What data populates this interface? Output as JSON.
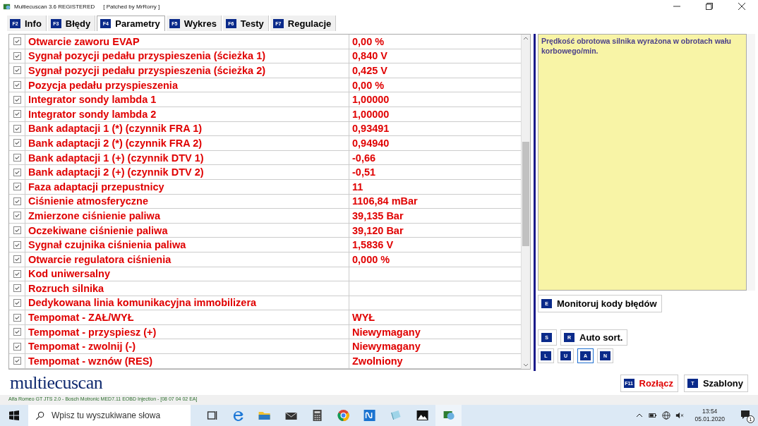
{
  "window": {
    "title": "Multiecuscan 3.6 REGISTERED",
    "subtitle": "[ Patched by MrRorry ]"
  },
  "tabs": [
    {
      "key": "F2",
      "label": "Info",
      "selected": false
    },
    {
      "key": "F3",
      "label": "Błędy",
      "selected": false
    },
    {
      "key": "F4",
      "label": "Parametry",
      "selected": true
    },
    {
      "key": "F5",
      "label": "Wykres",
      "selected": false
    },
    {
      "key": "F6",
      "label": "Testy",
      "selected": false
    },
    {
      "key": "F7",
      "label": "Regulacje",
      "selected": false
    }
  ],
  "parameters": [
    {
      "name": "Otwarcie zaworu EVAP",
      "value": "0,00 %",
      "checked": true
    },
    {
      "name": "Sygnał pozycji pedału przyspieszenia (ścieżka 1)",
      "value": "0,840 V",
      "checked": true
    },
    {
      "name": "Sygnał pozycji pedału przyspieszenia (ścieżka 2)",
      "value": "0,425 V",
      "checked": true
    },
    {
      "name": "Pozycja pedału przyspieszenia",
      "value": "0,00 %",
      "checked": true
    },
    {
      "name": "Integrator sondy lambda 1",
      "value": "1,00000",
      "checked": true
    },
    {
      "name": "Integrator sondy lambda 2",
      "value": "1,00000",
      "checked": true
    },
    {
      "name": "Bank adaptacji 1 (*) (czynnik FRA 1)",
      "value": "0,93491",
      "checked": true
    },
    {
      "name": "Bank adaptacji 2 (*) (czynnik FRA 2)",
      "value": "0,94940",
      "checked": true
    },
    {
      "name": "Bank adaptacji 1 (+) (czynnik DTV 1)",
      "value": "-0,66",
      "checked": true
    },
    {
      "name": "Bank adaptacji 2 (+) (czynnik DTV 2)",
      "value": "-0,51",
      "checked": true
    },
    {
      "name": "Faza adaptacji przepustnicy",
      "value": "11",
      "checked": true
    },
    {
      "name": "Ciśnienie atmosferyczne",
      "value": "1106,84 mBar",
      "checked": true
    },
    {
      "name": "Zmierzone ciśnienie paliwa",
      "value": "39,135 Bar",
      "checked": true
    },
    {
      "name": "Oczekiwane ciśnienie paliwa",
      "value": "39,120 Bar",
      "checked": true
    },
    {
      "name": "Sygnał czujnika ciśnienia paliwa",
      "value": "1,5836 V",
      "checked": true
    },
    {
      "name": "Otwarcie regulatora ciśnienia",
      "value": "0,000 %",
      "checked": true
    },
    {
      "name": "Kod uniwersalny",
      "checked": true
    },
    {
      "name": "Rozruch silnika",
      "checked": true
    },
    {
      "name": "Dedykowana linia komunikacyjna immobilizera",
      "checked": true
    },
    {
      "name": "Tempomat - ZAŁ/WYŁ",
      "value": "WYŁ",
      "checked": true
    },
    {
      "name": "Tempomat - przyspiesz (+)",
      "value": "Niewymagany",
      "checked": true
    },
    {
      "name": "Tempomat - zwolnij (-)",
      "value": "Niewymagany",
      "checked": true
    },
    {
      "name": "Tempomat - wznów (RES)",
      "value": "Zwolniony",
      "checked": true
    }
  ],
  "description": "Prędkość obrotowa silnika wyrażona w obrotach wału korbowego/min.",
  "monitor_button": {
    "key": "E",
    "label": "Monitoruj kody błędów"
  },
  "sort_buttons": [
    {
      "key": "S"
    },
    {
      "key": "R",
      "label": "Auto sort."
    }
  ],
  "mode_buttons": [
    {
      "key": "L",
      "selected": false
    },
    {
      "key": "U",
      "selected": false
    },
    {
      "key": "A",
      "selected": true
    },
    {
      "key": "N",
      "selected": false
    }
  ],
  "logo": "multiecuscan",
  "action_buttons": [
    {
      "key": "F11",
      "label": "Rozłącz",
      "kind": "danger"
    },
    {
      "key": "T",
      "label": "Szablony",
      "kind": "normal"
    }
  ],
  "status_bar": "Alfa Romeo GT JTS 2.0 - Bosch Motronic MED7.11 EOBD Injection - [08 07 04 02 EA]",
  "taskbar": {
    "search_placeholder": "Wpisz tu wyszukiwane słowa",
    "time": "13:54",
    "date": "05.01.2020",
    "notification_count": "1"
  }
}
